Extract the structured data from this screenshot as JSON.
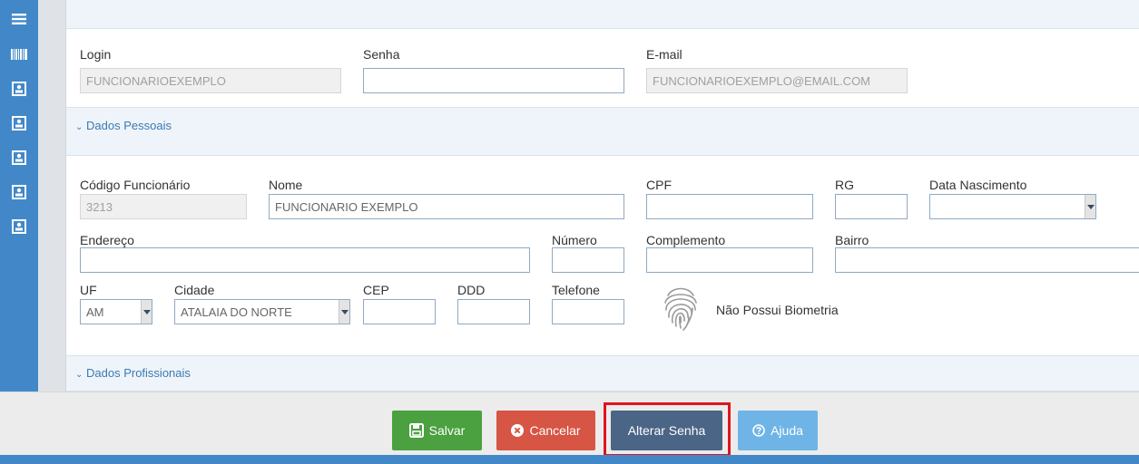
{
  "colors": {
    "sidebar": "#4288c8",
    "save": "#4ba040",
    "cancel": "#d65545",
    "change_password": "#4a6585",
    "help": "#6fb4e6",
    "highlight": "#e0141e"
  },
  "sidebar": {
    "items": [
      {
        "icon": "menu-icon"
      },
      {
        "icon": "barcode-icon"
      },
      {
        "icon": "contact-card-icon"
      },
      {
        "icon": "contact-card-icon"
      },
      {
        "icon": "contact-card-icon"
      },
      {
        "icon": "contact-card-icon"
      },
      {
        "icon": "contact-card-icon"
      }
    ]
  },
  "access": {
    "login_label": "Login",
    "login_value": "FUNCIONARIOEXEMPLO",
    "password_label": "Senha",
    "password_value": "",
    "email_label": "E-mail",
    "email_value": "FUNCIONARIOEXEMPLO@EMAIL.COM"
  },
  "personal": {
    "section_title": "Dados Pessoais",
    "code_label": "Código Funcionário",
    "code_value": "3213",
    "name_label": "Nome",
    "name_value": "FUNCIONARIO EXEMPLO",
    "cpf_label": "CPF",
    "cpf_value": "",
    "rg_label": "RG",
    "rg_value": "",
    "birth_label": "Data Nascimento",
    "birth_value": "",
    "address_label": "Endereço",
    "address_value": "",
    "number_label": "Número",
    "number_value": "",
    "complement_label": "Complemento",
    "complement_value": "",
    "district_label": "Bairro",
    "district_value": "",
    "uf_label": "UF",
    "uf_value": "AM",
    "city_label": "Cidade",
    "city_value": "ATALAIA DO NORTE",
    "cep_label": "CEP",
    "cep_value": "",
    "ddd_label": "DDD",
    "ddd_value": "",
    "phone_label": "Telefone",
    "phone_value": "",
    "biometry_text": "Não Possui Biometria"
  },
  "professional": {
    "section_title": "Dados Profissionais"
  },
  "footer": {
    "save_label": "Salvar",
    "cancel_label": "Cancelar",
    "change_password_label": "Alterar Senha",
    "help_label": "Ajuda"
  }
}
